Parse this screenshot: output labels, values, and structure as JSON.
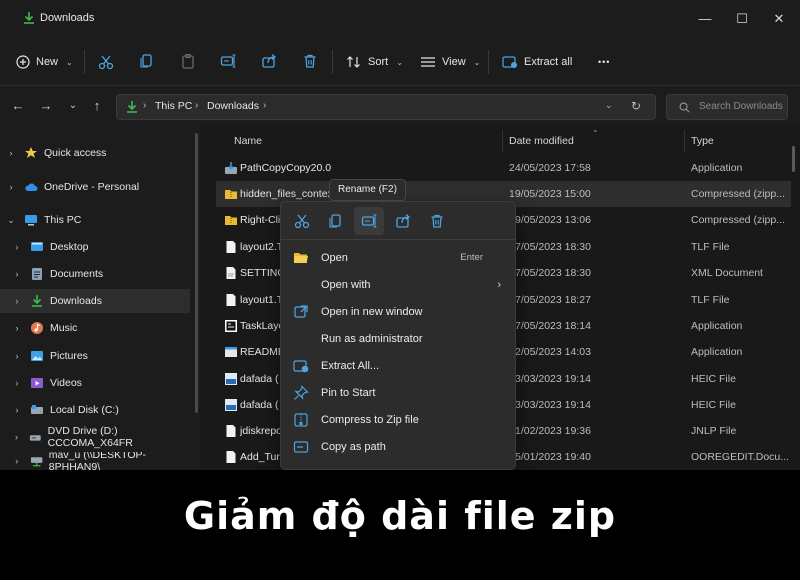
{
  "window": {
    "title": "Downloads",
    "controls": [
      "minimize-icon",
      "maximize-icon",
      "close-icon"
    ]
  },
  "toolbar": {
    "new_label": "New",
    "sort_label": "Sort",
    "view_label": "View",
    "extract_label": "Extract all",
    "more_label": "•••"
  },
  "address": {
    "crumbs": [
      "This PC",
      "Downloads"
    ],
    "search_placeholder": "Search Downloads"
  },
  "sidebar": {
    "items": [
      {
        "label": "Quick access",
        "icon": "star-icon"
      },
      {
        "label": "OneDrive - Personal",
        "icon": "cloud-icon"
      },
      {
        "label": "This PC",
        "icon": "pc-icon"
      },
      {
        "label": "Desktop",
        "icon": "desktop-icon"
      },
      {
        "label": "Documents",
        "icon": "documents-icon"
      },
      {
        "label": "Downloads",
        "icon": "download-icon"
      },
      {
        "label": "Music",
        "icon": "music-icon"
      },
      {
        "label": "Pictures",
        "icon": "pictures-icon"
      },
      {
        "label": "Videos",
        "icon": "videos-icon"
      },
      {
        "label": "Local Disk  (C:)",
        "icon": "disk-icon"
      },
      {
        "label": "DVD Drive (D:) CCCOMA_X64FR",
        "icon": "dvd-icon"
      },
      {
        "label": "mav_u (\\\\DESKTOP-8PHHAN9\\",
        "icon": "network-drive-icon"
      }
    ]
  },
  "columns": {
    "name": "Name",
    "date": "Date modified",
    "type": "Type"
  },
  "files": [
    {
      "name": "PathCopyCopy20.0",
      "date": "24/05/2023 17:58",
      "type": "Application"
    },
    {
      "name": "hidden_files_contex",
      "date": "19/05/2023 15:00",
      "type": "Compressed (zipp..."
    },
    {
      "name": "Right-Cli",
      "date": "9/05/2023 13:06",
      "type": "Compressed (zipp..."
    },
    {
      "name": "layout2.T",
      "date": "7/05/2023 18:30",
      "type": "TLF File"
    },
    {
      "name": "SETTINGS",
      "date": "7/05/2023 18:30",
      "type": "XML Document"
    },
    {
      "name": "layout1.T",
      "date": "7/05/2023 18:27",
      "type": "TLF File"
    },
    {
      "name": "TaskLayo",
      "date": "7/05/2023 18:14",
      "type": "Application"
    },
    {
      "name": "README",
      "date": "2/05/2023 14:03",
      "type": "Application"
    },
    {
      "name": "dafada (",
      "date": "3/03/2023 19:14",
      "type": "HEIC File"
    },
    {
      "name": "dafada (",
      "date": "3/03/2023 19:14",
      "type": "HEIC File"
    },
    {
      "name": "jdiskrepo",
      "date": "1/02/2023 19:36",
      "type": "JNLP File"
    },
    {
      "name": "Add_Turn",
      "date": "5/01/2023 19:40",
      "type": "OOREGEDIT.Docu..."
    }
  ],
  "tooltip": "Rename (F2)",
  "context_menu": {
    "items": [
      {
        "label": "Open",
        "accel": "Enter"
      },
      {
        "label": "Open with",
        "submenu": true
      },
      {
        "label": "Open in new window"
      },
      {
        "label": "Run as administrator"
      },
      {
        "label": "Extract All..."
      },
      {
        "label": "Pin to Start"
      },
      {
        "label": "Compress to Zip file"
      },
      {
        "label": "Copy as path"
      }
    ]
  },
  "banner": {
    "text": "Giảm độ dài file zip"
  },
  "colors": {
    "accent_green": "#3fb950",
    "folder_yellow": "#e8b931",
    "accent_blue": "#4ea3e0"
  }
}
